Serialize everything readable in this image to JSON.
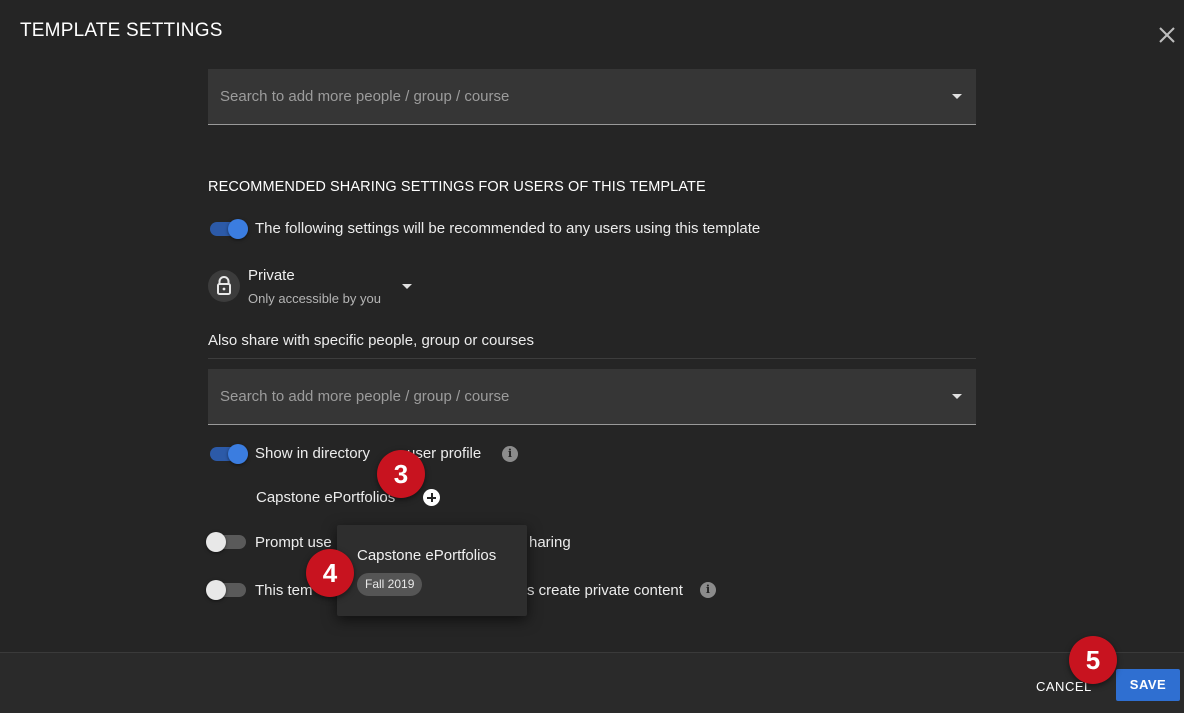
{
  "dialog": {
    "title": "TEMPLATE SETTINGS"
  },
  "top_search": {
    "placeholder": "Search to add more people / group / course"
  },
  "sharing": {
    "heading": "RECOMMENDED SHARING SETTINGS FOR USERS OF THIS TEMPLATE",
    "recommend_toggle_label": "The following settings will be recommended to any users using this template",
    "recommend_toggle_on": true,
    "privacy_title": "Private",
    "privacy_subtitle": "Only accessible by you",
    "also_share_label": "Also share with specific people, group or courses",
    "share_search_placeholder": "Search to add more people / group / course",
    "directory_toggle_label_a": "Show in directory",
    "directory_toggle_label_b": "user profile",
    "directory_toggle_on": true,
    "directory_item": "Capstone ePortfolios",
    "prompt_toggle_label_a": "Prompt use",
    "prompt_toggle_label_b": "haring",
    "prompt_toggle_on": false,
    "private_toggle_label_a": "This tem",
    "private_toggle_label_b": "s create private content",
    "private_toggle_on": false
  },
  "popover": {
    "title": "Capstone ePortfolios",
    "chip": "Fall 2019"
  },
  "badges": {
    "step3": "3",
    "step4": "4",
    "step5": "5"
  },
  "footer": {
    "cancel_label": "CANCEL",
    "save_label": "SAVE"
  },
  "colors": {
    "accent": "#2f6fd1",
    "badge": "#c8131f",
    "background": "#252525"
  },
  "icons": {
    "close": "close-icon",
    "caret": "caret-down-icon",
    "lock": "lock-icon",
    "info": "info-icon",
    "plus": "plus-circle-icon"
  }
}
